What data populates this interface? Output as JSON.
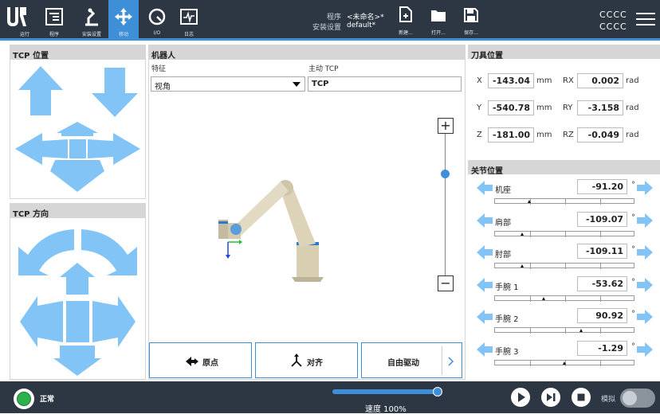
{
  "app": {
    "logo": "UR"
  },
  "nav": {
    "items": [
      {
        "label": "运行",
        "icon": "run-icon"
      },
      {
        "label": "程序",
        "icon": "program-icon"
      },
      {
        "label": "安装设置",
        "icon": "installation-icon"
      },
      {
        "label": "移动",
        "icon": "move-icon",
        "active": true
      },
      {
        "label": "I/O",
        "icon": "io-icon"
      },
      {
        "label": "日志",
        "icon": "log-icon"
      }
    ]
  },
  "header": {
    "program_label": "程序",
    "program_value": "<未命名>*",
    "install_label": "安装设置",
    "install_value": "default*",
    "file_buttons": [
      {
        "label": "新建...",
        "icon": "new-file-icon"
      },
      {
        "label": "打开...",
        "icon": "open-folder-icon"
      },
      {
        "label": "保存...",
        "icon": "save-icon"
      }
    ],
    "user_line1": "CCCC",
    "user_line2": "CCCC"
  },
  "tcp_position": {
    "title": "TCP 位置"
  },
  "tcp_orientation": {
    "title": "TCP 方向"
  },
  "robot": {
    "title": "机器人",
    "feature_label": "特征",
    "feature_value": "视角",
    "active_tcp_label": "主动 TCP",
    "active_tcp_value": "TCP",
    "zoom_in": "+",
    "zoom_out": "−",
    "zoom_level": 0.72,
    "home_button": "原点",
    "align_button": "对齐",
    "freedrive_button": "自由驱动"
  },
  "tool_position": {
    "title": "刀具位置",
    "rows": [
      {
        "axis": "X",
        "value": "-143.04",
        "unit": "mm",
        "raxis": "RX",
        "rvalue": "0.002",
        "runit": "rad"
      },
      {
        "axis": "Y",
        "value": "-540.78",
        "unit": "mm",
        "raxis": "RY",
        "rvalue": "-3.158",
        "runit": "rad"
      },
      {
        "axis": "Z",
        "value": "-181.00",
        "unit": "mm",
        "raxis": "RZ",
        "rvalue": "-0.049",
        "runit": "rad"
      }
    ]
  },
  "joint_position": {
    "title": "关节位置",
    "unit": "°",
    "joints": [
      {
        "name": "机座",
        "value": "-91.20",
        "level": 0.25
      },
      {
        "name": "肩部",
        "value": "-109.07",
        "level": 0.2
      },
      {
        "name": "肘部",
        "value": "-109.11",
        "level": 0.2
      },
      {
        "name": "手腕 1",
        "value": "-53.62",
        "level": 0.35
      },
      {
        "name": "手腕 2",
        "value": "90.92",
        "level": 0.62
      },
      {
        "name": "手腕 3",
        "value": "-1.29",
        "level": 0.5
      }
    ]
  },
  "status": {
    "state": "正常",
    "speed_label": "速度 100%",
    "speed_fraction": 1.0,
    "simulation_label": "模拟"
  }
}
